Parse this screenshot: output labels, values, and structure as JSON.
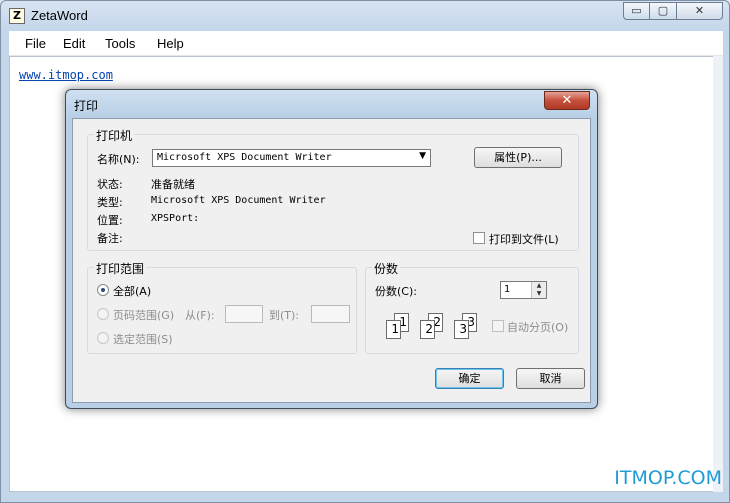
{
  "window": {
    "title": "ZetaWord",
    "app_icon_letter": "Z",
    "minimize_glyph": "▭",
    "maximize_glyph": "▢",
    "close_glyph": "✕"
  },
  "menu": [
    "File",
    "Edit",
    "Tools",
    "Help"
  ],
  "document": {
    "link_text": "www.itmop.com"
  },
  "watermark": "ITMOP.COM",
  "dialog": {
    "title": "打印",
    "close_glyph": "✕",
    "printer_group": {
      "title": "打印机",
      "name_label": "名称(N):",
      "name_value": "Microsoft XPS Document Writer",
      "properties_button": "属性(P)...",
      "status_label": "状态:",
      "status_value": "准备就绪",
      "type_label": "类型:",
      "type_value": "Microsoft XPS Document Writer",
      "where_label": "位置:",
      "where_value": "XPSPort:",
      "comment_label": "备注:",
      "print_to_file_label": "打印到文件(L)"
    },
    "range_group": {
      "title": "打印范围",
      "all_label": "全部(A)",
      "pages_label": "页码范围(G)",
      "from_label": "从(F):",
      "to_label": "到(T):",
      "selection_label": "选定范围(S)"
    },
    "copies_group": {
      "title": "份数",
      "count_label": "份数(C):",
      "count_value": "1",
      "collate_label": "自动分页(O)",
      "collate_pages": [
        "1",
        "1",
        "2",
        "2",
        "3",
        "3"
      ]
    },
    "ok_button": "确定",
    "cancel_button": "取消"
  }
}
